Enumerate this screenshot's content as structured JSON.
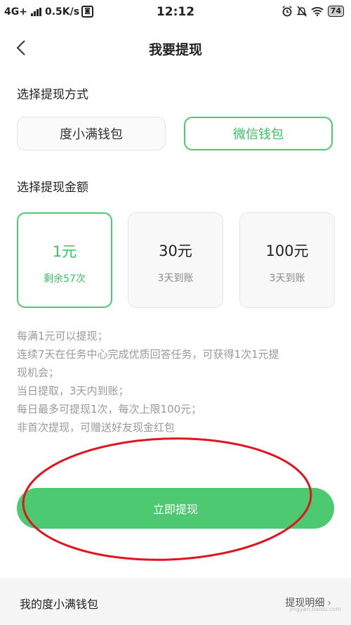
{
  "status_bar": {
    "network": "4G+",
    "speed": "0.5K/s",
    "time": "12:12",
    "battery": "74"
  },
  "header": {
    "title": "我要提现"
  },
  "method_section": {
    "label": "选择提现方式",
    "options": [
      {
        "label": "度小满钱包",
        "selected": false
      },
      {
        "label": "微信钱包",
        "selected": true
      }
    ]
  },
  "amount_section": {
    "label": "选择提现金额",
    "options": [
      {
        "value": "1元",
        "sub": "剩余57次",
        "selected": true
      },
      {
        "value": "30元",
        "sub": "3天到账",
        "selected": false
      },
      {
        "value": "100元",
        "sub": "3天到账",
        "selected": false
      }
    ]
  },
  "rules": [
    "每满1元可以提现；",
    "连续7天在任务中心完成优质回答任务，可获得1次1元提",
    "现机会；",
    "当日提取，3天内到账；",
    "每日最多可提现1次，每次上限100元；",
    "非首次提现，可赠送好友现金红包"
  ],
  "cta": {
    "label": "立即提现"
  },
  "bottom_bar": {
    "left_label": "我的度小满钱包",
    "right_label": "提现明细"
  },
  "watermark": "jingyan.baidu.com",
  "colors": {
    "accent": "#4cc971",
    "annotation": "#e0141e"
  }
}
